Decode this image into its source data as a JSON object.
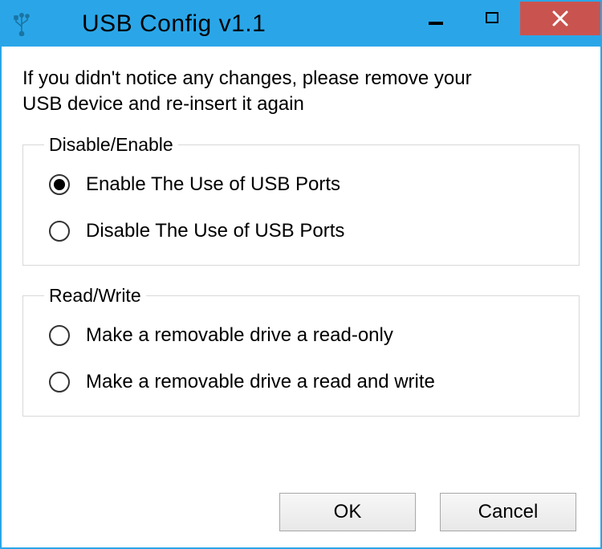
{
  "window": {
    "title": "USB Config v1.1"
  },
  "info": "If you didn't notice any changes, please remove your USB device and re-insert it again",
  "group1": {
    "legend": "Disable/Enable",
    "option1": "Enable The Use of USB Ports",
    "option2": "Disable The Use of USB Ports"
  },
  "group2": {
    "legend": "Read/Write",
    "option1": "Make a removable drive a read-only",
    "option2": "Make a removable drive a read and write"
  },
  "buttons": {
    "ok": "OK",
    "cancel": "Cancel"
  }
}
